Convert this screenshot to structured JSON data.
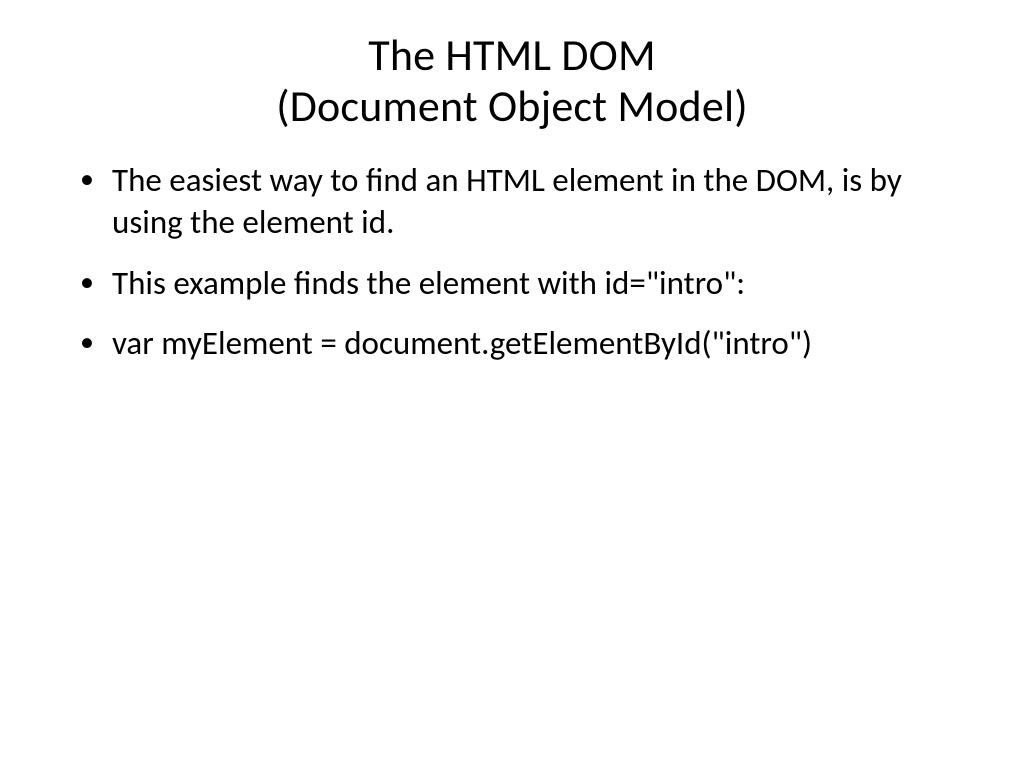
{
  "title_line1": "The HTML DOM",
  "title_line2": "(Document Object Model)",
  "bullets": [
    "The easiest way to find an HTML element in the DOM, is by using the element id.",
    "This example finds the element with id=\"intro\":",
    "var myElement = document.getElementById(\"intro\")"
  ]
}
